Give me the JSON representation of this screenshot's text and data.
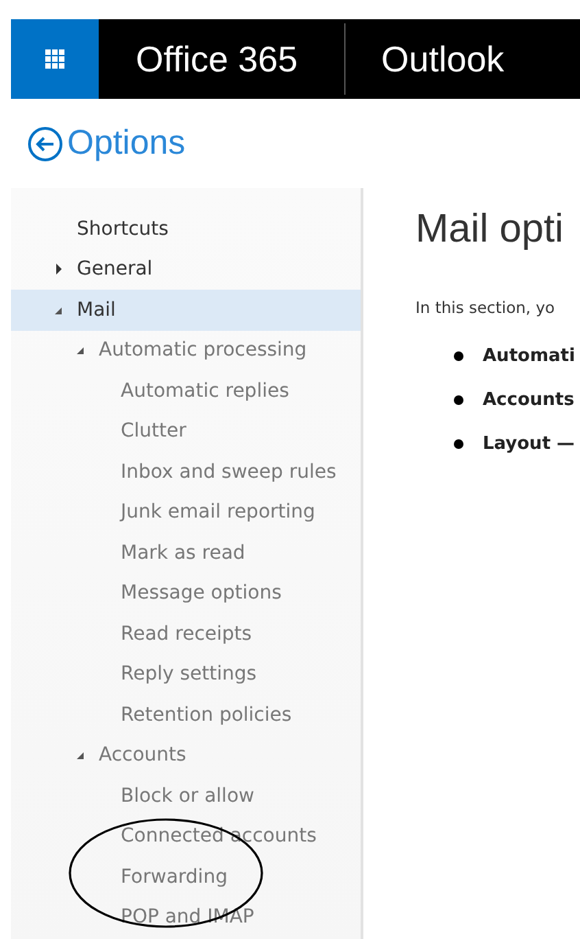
{
  "header": {
    "suite_title": "Office 365",
    "app_title": "Outlook"
  },
  "page_title": "Options",
  "nav": [
    {
      "label": "Shortcuts",
      "selected": false
    },
    {
      "label": "General",
      "selected": false,
      "expanded": false
    },
    {
      "label": "Mail",
      "selected": true,
      "expanded": true,
      "children": [
        {
          "label": "Automatic processing",
          "selected": false,
          "expanded": true,
          "children": [
            {
              "label": "Automatic replies",
              "selected": false
            },
            {
              "label": "Clutter",
              "selected": false
            },
            {
              "label": "Inbox and sweep rules",
              "selected": false
            },
            {
              "label": "Junk email reporting",
              "selected": false
            },
            {
              "label": "Mark as read",
              "selected": false
            },
            {
              "label": "Message options",
              "selected": false
            },
            {
              "label": "Read receipts",
              "selected": false
            },
            {
              "label": "Reply settings",
              "selected": false
            },
            {
              "label": "Retention policies",
              "selected": false
            }
          ]
        },
        {
          "label": "Accounts",
          "selected": false,
          "expanded": true,
          "children": [
            {
              "label": "Block or allow",
              "selected": false
            },
            {
              "label": "Connected accounts",
              "selected": false
            },
            {
              "label": "Forwarding",
              "selected": false
            },
            {
              "label": "POP and IMAP",
              "selected": false
            }
          ]
        }
      ]
    }
  ],
  "main": {
    "title": "Mail opti",
    "intro": "In this section, yo",
    "bullets": [
      "Automati",
      "Accounts",
      "Layout —"
    ]
  }
}
